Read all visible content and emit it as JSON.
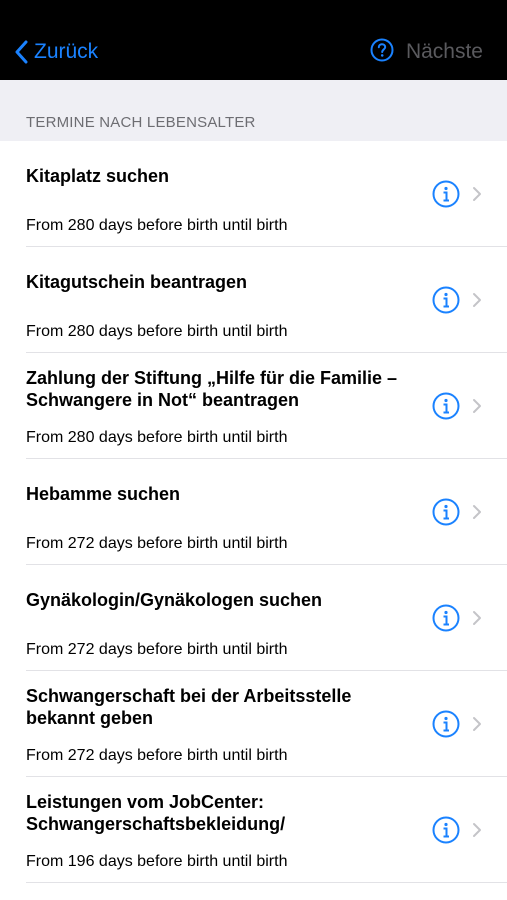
{
  "navbar": {
    "back_label": "Zurück",
    "next_label": "Nächste",
    "accent_color": "#1a82ff"
  },
  "section": {
    "title": "TERMINE NACH LEBENSALTER"
  },
  "items": [
    {
      "title": "Kitaplatz suchen",
      "subtitle": "From 280 days before birth until birth"
    },
    {
      "title": "Kitagutschein beantragen",
      "subtitle": "From 280 days before birth until birth"
    },
    {
      "title": "Zahlung der Stiftung „Hilfe für die Familie – Schwangere in Not“ beantragen",
      "subtitle": "From 280 days before birth until birth"
    },
    {
      "title": "Hebamme suchen",
      "subtitle": "From 272 days before birth until birth"
    },
    {
      "title": "Gynäkologin/Gynäkologen suchen",
      "subtitle": "From 272 days before birth until birth"
    },
    {
      "title": "Schwangerschaft bei der Arbeitsstelle bekannt geben",
      "subtitle": "From 272 days before birth until birth"
    },
    {
      "title": "Leistungen vom JobCenter: Schwangerschaftsbekleidung/",
      "subtitle": "From 196 days before birth until birth"
    }
  ]
}
